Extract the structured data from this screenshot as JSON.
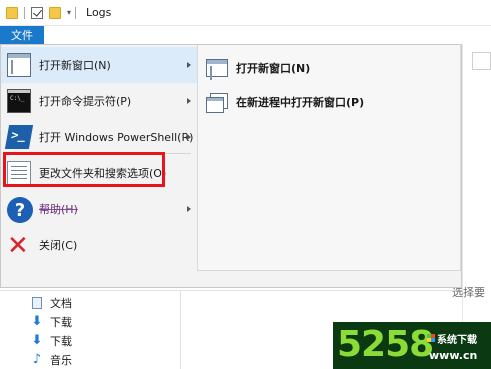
{
  "title_bar": {
    "window_title": "Logs",
    "icons": [
      "folder-icon",
      "checkbox-icon",
      "folder-icon",
      "dropdown-icon"
    ]
  },
  "ribbon": {
    "file_tab": "文件"
  },
  "file_menu": {
    "items": [
      {
        "label": "打开新窗口(N)",
        "icon": "new-window-icon",
        "has_submenu": true,
        "active": true
      },
      {
        "label": "打开命令提示符(P)",
        "icon": "cmd-icon",
        "has_submenu": true
      },
      {
        "label": "打开 Windows PowerShell(R)",
        "icon": "powershell-icon",
        "has_submenu": true
      },
      {
        "label": "更改文件夹和搜索选项(O)",
        "icon": "folder-options-icon",
        "has_submenu": false,
        "highlighted": true
      },
      {
        "label": "帮助(H)",
        "icon": "help-icon",
        "has_submenu": true
      },
      {
        "label": "关闭(C)",
        "icon": "close-icon",
        "has_submenu": false
      }
    ],
    "submenu": [
      {
        "label": "打开新窗口(N)",
        "icon": "new-window-icon"
      },
      {
        "label": "在新进程中打开新窗口(P)",
        "icon": "new-process-window-icon"
      }
    ]
  },
  "nav_pane": {
    "items": [
      {
        "label": "文档",
        "icon": "document-icon"
      },
      {
        "label": "下载",
        "icon": "download-icon"
      },
      {
        "label": "下载",
        "icon": "download-icon"
      },
      {
        "label": "音乐",
        "icon": "music-icon"
      }
    ]
  },
  "background": {
    "status_text": "选择要"
  },
  "watermark": {
    "number": "5258",
    "site_name": "系统下载",
    "url": "www.cn"
  },
  "colors": {
    "accent": "#1979ca",
    "highlight_border": "#e8141c",
    "menu_bg": "#f3f3f3",
    "active_item_bg": "#dcebfa"
  }
}
